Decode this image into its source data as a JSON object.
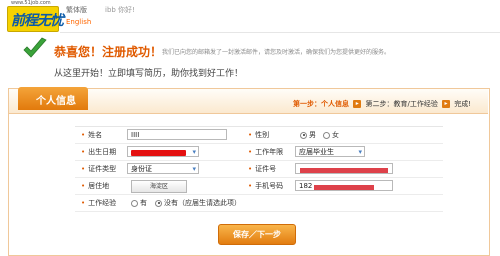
{
  "header": {
    "site_url": "www.51job.com",
    "logo_text": "前程无忧",
    "lang_cn": "繁体版",
    "lang_en": "English",
    "greeting": "ibb 你好!"
  },
  "success": {
    "title": "恭喜您！注册成功！",
    "note": "我们已向您的邮箱发了一封激活邮件，请您及时激活，确保我们为您提供更好的服务。",
    "subtitle": "从这里开始！立即填写简历，助你找到好工作！"
  },
  "panel": {
    "tab_label": "个人信息",
    "steps": {
      "step1": "第一步：个人信息",
      "step2": "第二步：教育/工作经验",
      "step3": "完成!"
    }
  },
  "form": {
    "name_label": "姓名",
    "name_value": "IIII",
    "gender_label": "性别",
    "gender_male": "男",
    "gender_female": "女",
    "gender_selected": "男",
    "birth_label": "出生日期",
    "work_years_label": "工作年限",
    "work_years_value": "应届毕业生",
    "id_type_label": "证件类型",
    "id_type_value": "身份证",
    "id_number_label": "证件号",
    "residence_label": "居住地",
    "residence_value": "海淀区",
    "mobile_label": "手机号码",
    "mobile_prefix": "182",
    "experience_label": "工作经验",
    "exp_yes": "有",
    "exp_no": "没有（应届生请选此项）",
    "exp_selected": "没有（应届生请选此项）"
  },
  "buttons": {
    "save_next": "保存／下一步"
  },
  "colors": {
    "accent": "#e27a0c",
    "title_orange": "#e05a00",
    "logo_yellow": "#f6d200",
    "logo_blue": "#0b5aa8",
    "redaction": "#e41010"
  },
  "icons": {
    "success": "check-icon",
    "step_arrow": "arrow-right-icon"
  }
}
